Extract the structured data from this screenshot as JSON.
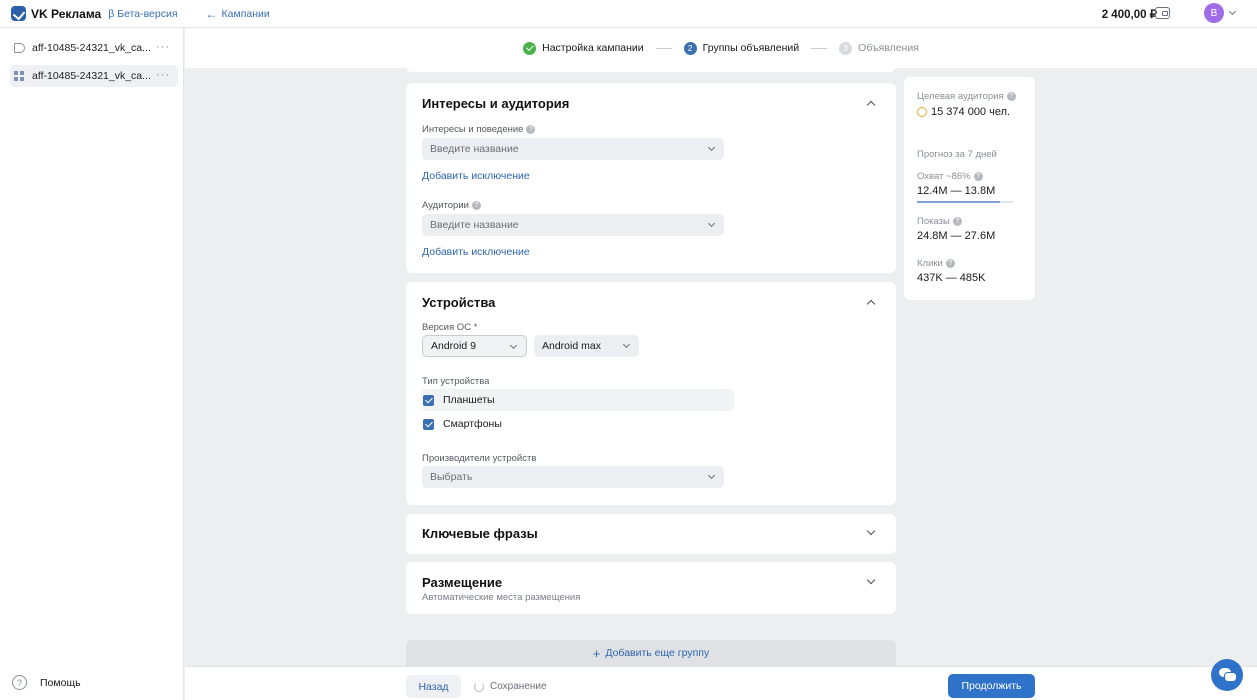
{
  "header": {
    "logo_text": "VK Реклама",
    "beta": "β Бета-версия",
    "back_arrow": "←",
    "back_link": "Кампании",
    "balance": "2 400,00 ₽",
    "avatar_letter": "B"
  },
  "sidebar": {
    "items": [
      {
        "label": "aff-10485-24321_vk_ca...",
        "icon": "megaphone-icon",
        "dots": "···"
      },
      {
        "label": "aff-10485-24321_vk_ca...",
        "icon": "grid-icon",
        "dots": "···"
      }
    ],
    "help": "Помощь",
    "help_icon": "?"
  },
  "stepper": {
    "steps": [
      {
        "label": "Настройка кампании",
        "marker": "",
        "state": "done"
      },
      {
        "label": "Группы объявлений",
        "marker": "2",
        "state": "current"
      },
      {
        "label": "Объявления",
        "marker": "3",
        "state": "future"
      }
    ]
  },
  "interests": {
    "title": "Интересы и аудитория",
    "interests_label": "Интересы и поведение",
    "interests_placeholder": "Введите название",
    "add_exclusion_1": "Добавить исключение",
    "audiences_label": "Аудитории",
    "audiences_placeholder": "Введите название",
    "add_exclusion_2": "Добавить исключение",
    "help_mark": "?"
  },
  "devices": {
    "title": "Устройства",
    "os_label": "Версия ОС *",
    "os_from": "Android 9",
    "os_to": "Android max",
    "type_label": "Тип устройства",
    "types": [
      {
        "label": "Планшеты",
        "checked": true
      },
      {
        "label": "Смартфоны",
        "checked": true
      }
    ],
    "makers_label": "Производители устройств",
    "makers_placeholder": "Выбрать"
  },
  "keywords": {
    "title": "Ключевые фразы"
  },
  "placement": {
    "title": "Размещение",
    "subtitle": "Автоматические места размещения"
  },
  "add_group": {
    "plus": "+",
    "label": "Добавить еще группу"
  },
  "panel": {
    "target_label": "Целевая аудитория",
    "target_value": "15 374 000 чел.",
    "forecast_label": "Прогноз за 7 дней",
    "reach_label": "Охват ~86%",
    "reach_value": "12.4M — 13.8M",
    "reach_fill": 0.86,
    "impressions_label": "Показы",
    "impressions_value": "24.8M — 27.6M",
    "clicks_label": "Клики",
    "clicks_value": "437K — 485K",
    "help_mark": "?"
  },
  "footer": {
    "back": "Назад",
    "saving": "Сохранение",
    "next": "Продолжить"
  },
  "colors": {
    "accent": "#2f72c9",
    "link": "#2f66ad",
    "success": "#4bb34b",
    "avatar": "#a06ce8"
  }
}
